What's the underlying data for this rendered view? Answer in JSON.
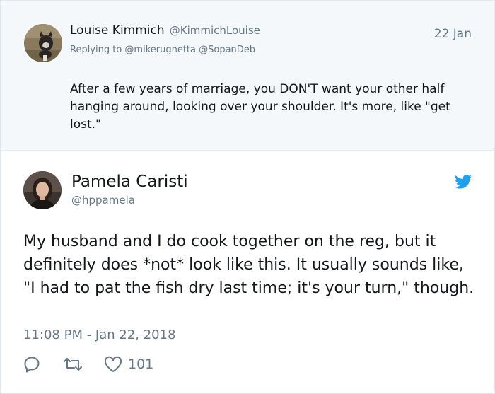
{
  "reply_tweet": {
    "name": "Louise Kimmich",
    "handle": "@KimmichLouise",
    "date": "22 Jan",
    "replying_to": "Replying to @mikerugnetta @SopanDeb",
    "text": "After a few years of marriage, you DON'T want your other half hanging around, looking over your shoulder. It's more, like \"get lost.\"",
    "avatar_icon": "dog-photo-avatar"
  },
  "main_tweet": {
    "name": "Pamela Caristi",
    "handle": "@hppamela",
    "text": "My husband and I do cook together on the reg, but it definitely does *not* look like this. It usually sounds like, \"I had to pat the fish dry last time; it's your turn,\" though.",
    "timestamp": "11:08 PM - Jan 22, 2018",
    "like_count": "101",
    "avatar_icon": "woman-photo-avatar",
    "brand_icon": "twitter-bird-icon"
  },
  "colors": {
    "brand": "#1da1f2",
    "text": "#14171a",
    "muted": "#657786",
    "reply_bg": "#f5f8fa"
  }
}
